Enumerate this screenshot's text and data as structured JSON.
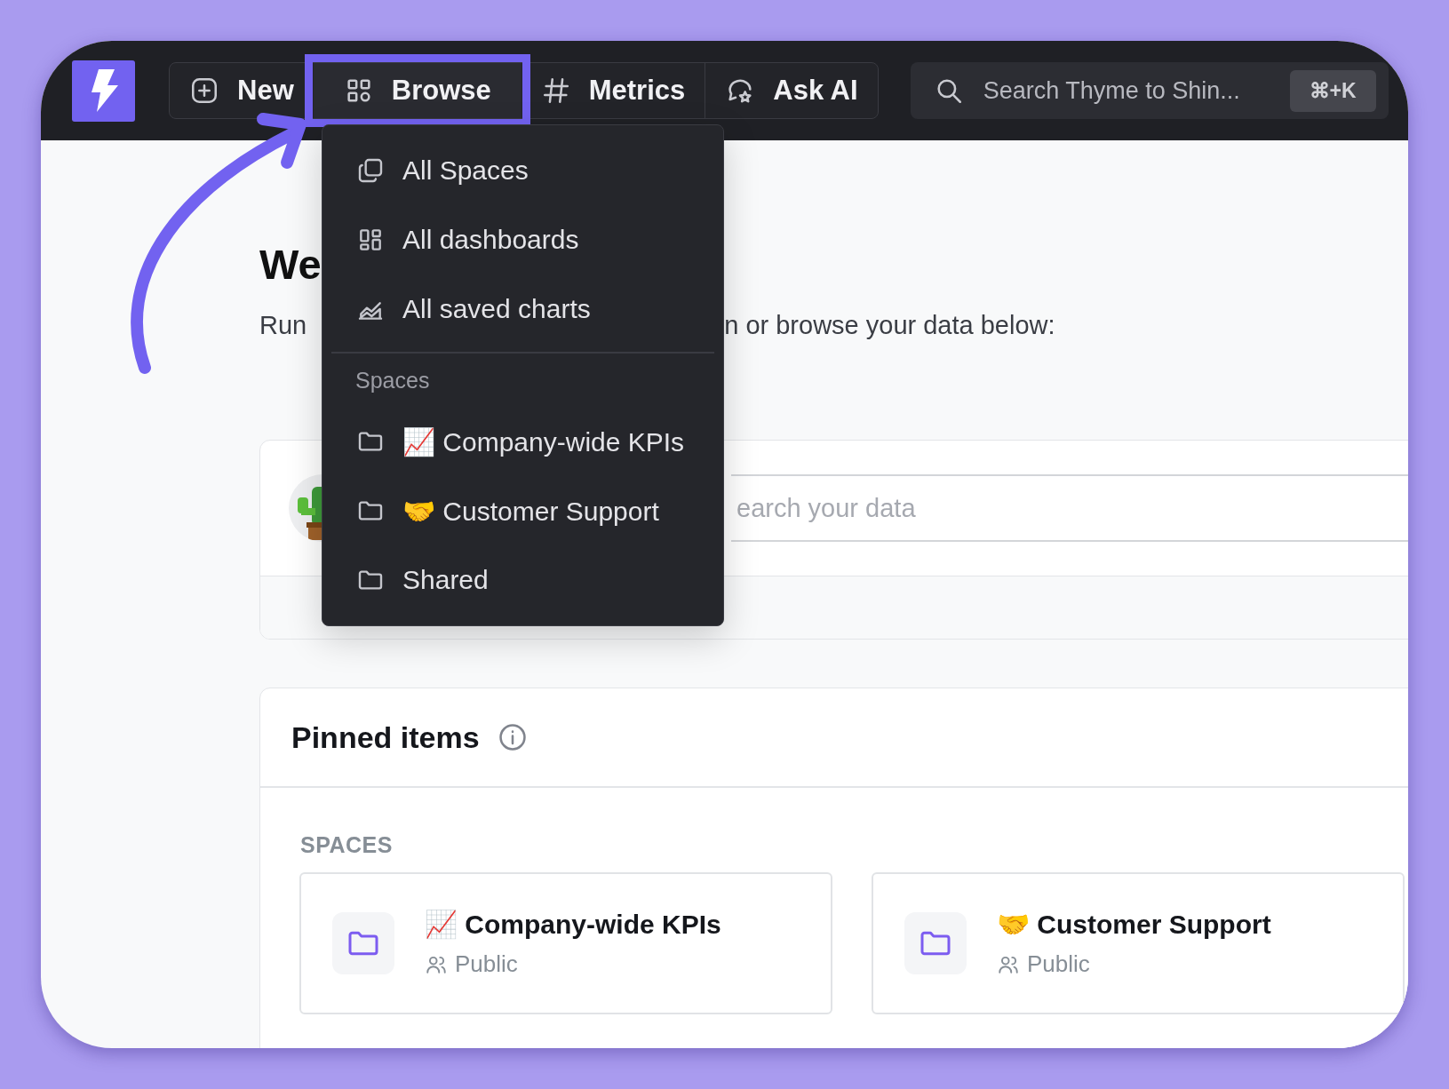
{
  "nav": [
    {
      "label": "New",
      "kind": "plus",
      "selected": false
    },
    {
      "label": "Browse",
      "kind": "grid",
      "selected": true
    },
    {
      "label": "Metrics",
      "kind": "hash",
      "selected": false
    },
    {
      "label": "Ask AI",
      "kind": "ai",
      "selected": false
    }
  ],
  "search": {
    "placeholder": "Search Thyme to Shin...",
    "shortcut": "⌘+K"
  },
  "browse_menu": {
    "items": [
      {
        "label": "All Spaces",
        "kind": "spaces"
      },
      {
        "label": "All dashboards",
        "kind": "dashboards"
      },
      {
        "label": "All saved charts",
        "kind": "charts"
      }
    ],
    "section": "Spaces",
    "spaces": [
      {
        "label": "📈 Company-wide KPIs"
      },
      {
        "label": "🤝 Customer Support"
      },
      {
        "label": "Shared"
      }
    ]
  },
  "welcome": {
    "title": "We",
    "subtitle_start": "Run",
    "subtitle_end": "n or browse your data below:"
  },
  "data_search": {
    "placeholder": "earch your data"
  },
  "pinned": {
    "title": "Pinned items",
    "section": "SPACES",
    "spaces": [
      {
        "title": "📈 Company-wide KPIs",
        "access": "Public"
      },
      {
        "title": "🤝 Customer Support",
        "access": "Public"
      }
    ]
  }
}
